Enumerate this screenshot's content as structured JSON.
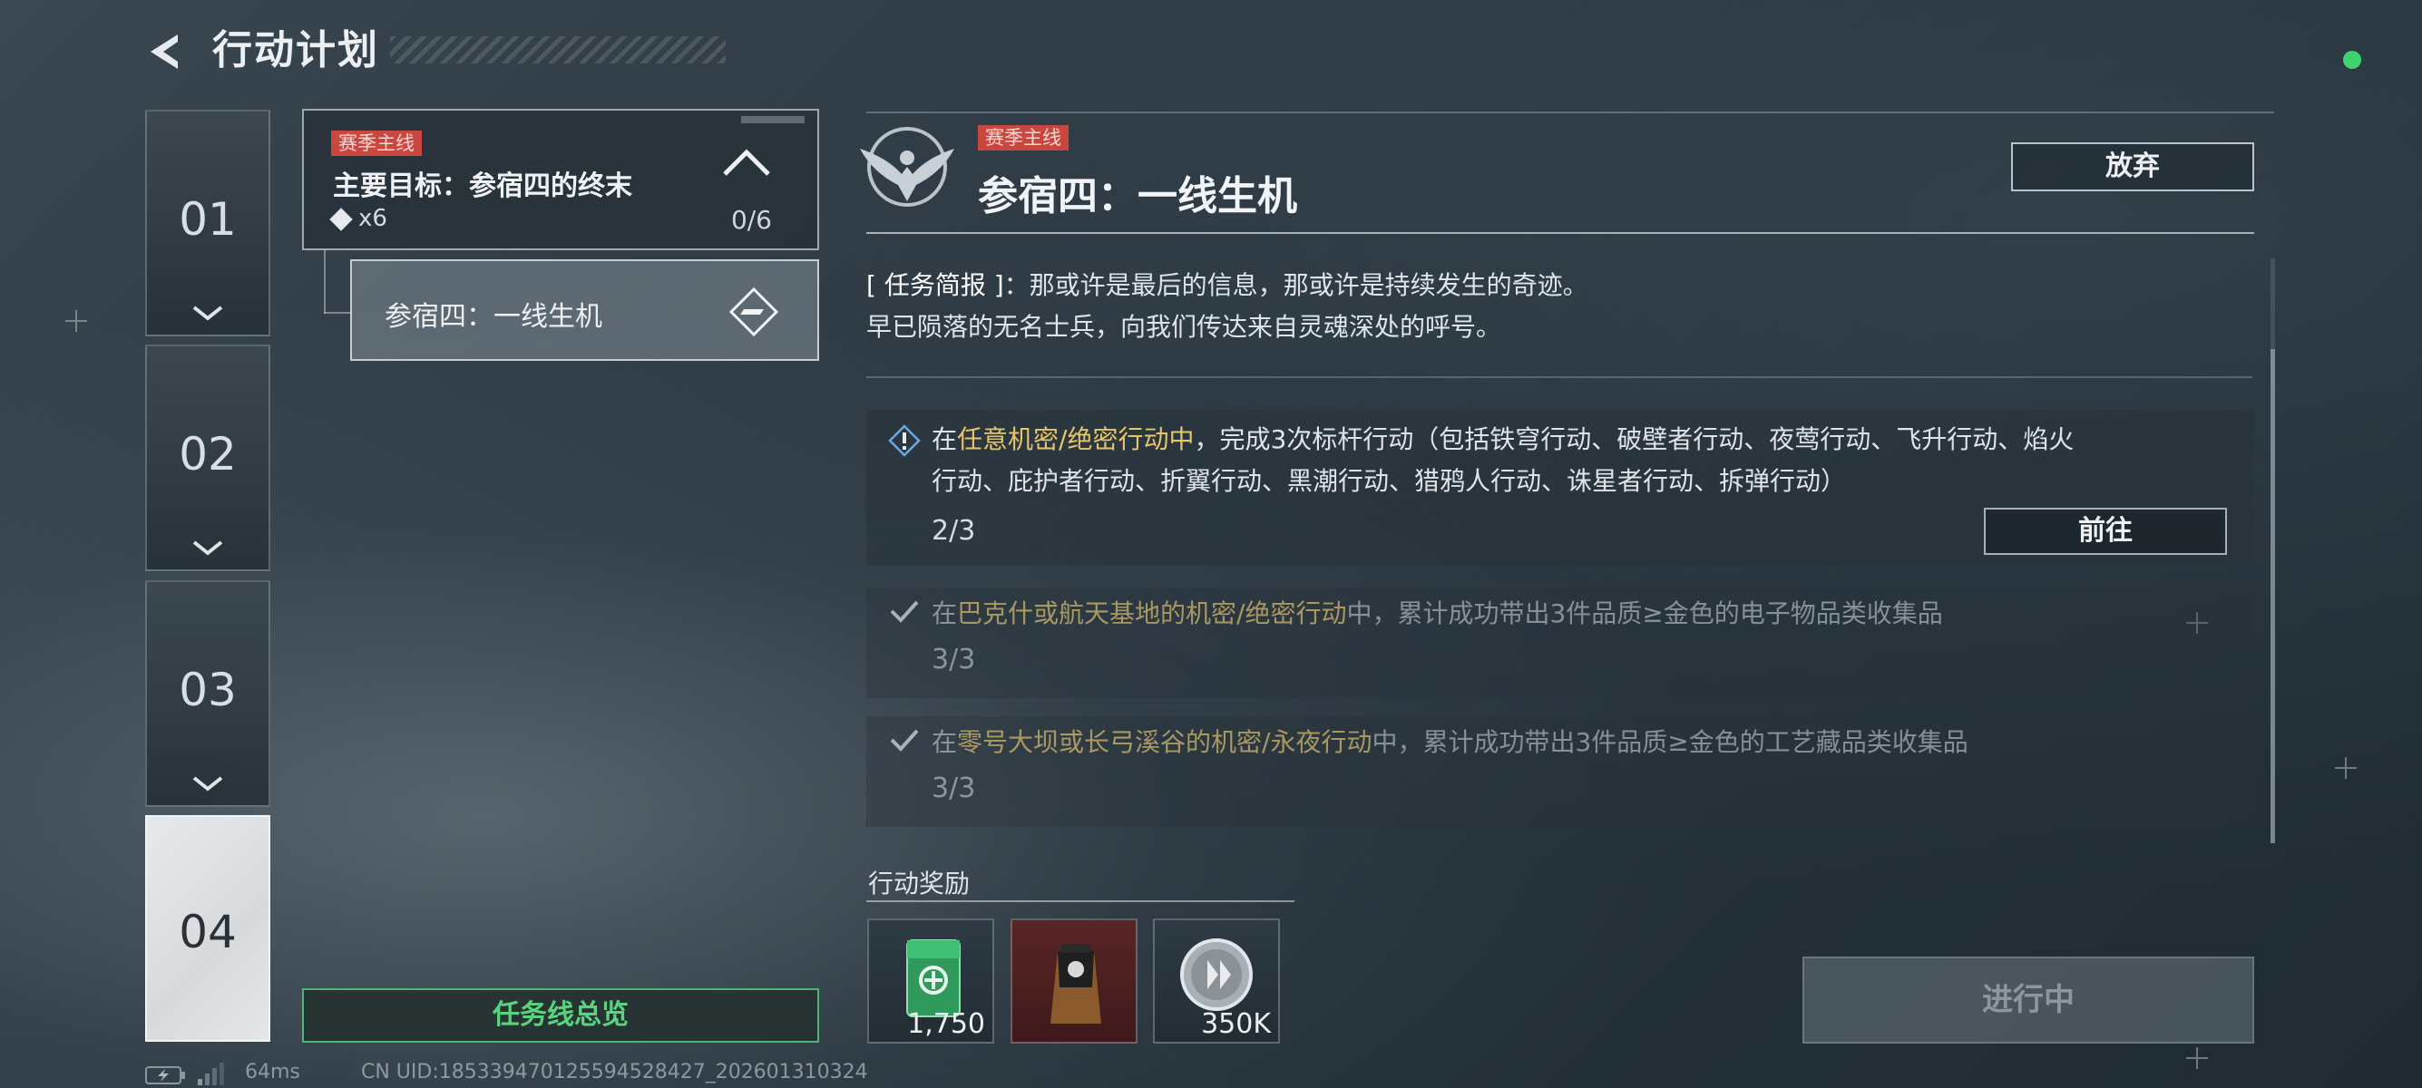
{
  "header": {
    "title": "行动计划"
  },
  "chapters": [
    {
      "label": "01",
      "active": false
    },
    {
      "label": "02",
      "active": false
    },
    {
      "label": "03",
      "active": false
    },
    {
      "label": "04",
      "active": true
    }
  ],
  "mission_card": {
    "tag": "赛季主线",
    "title": "主要目标：参宿四的终末",
    "reward": "x6",
    "progress": "0/6"
  },
  "sub_mission": {
    "label": "参宿四：一线生机"
  },
  "overview_button": "任务线总览",
  "status_bar": {
    "ping": "64ms",
    "uid": "CN UID:18533947012559452842​7_202601310324"
  },
  "detail": {
    "tag": "赛季主线",
    "title": "参宿四：一线生机",
    "abandon_label": "放弃",
    "briefing": {
      "prefix": "[ 任务简报 ]",
      "line1": "：那或许是最后的信息，那或许是持续发生的奇迹。",
      "line2": "早已陨落的无名士兵，向我们传达来自灵魂深处的呼号。"
    },
    "objectives": [
      {
        "state": "in-progress",
        "pre": "在",
        "highlight": "任意机密/绝密行动中",
        "post": "，完成3次标杆行动（包括铁穹行动、破壁者行动、夜莺行动、飞升行动、焰火",
        "line2": "行动、庇护者行动、折翼行动、黑潮行动、猎鸦人行动、诛星者行动、拆弹行动）",
        "progress": "2/3",
        "action": "前往"
      },
      {
        "state": "done",
        "pre": "在",
        "highlight": "巴克什或航天基地的机密/绝密行动",
        "post": "中，累计成功带出3件品质≥金色的电子物品类收集品",
        "progress": "3/3"
      },
      {
        "state": "done",
        "pre": "在",
        "highlight": "零号大坝或长弓溪谷的机密/永夜行动",
        "post": "中，累计成功带出3件品质≥金色的工艺藏品类收集品",
        "progress": "3/3"
      }
    ],
    "rewards_title": "行动奖励",
    "rewards": [
      {
        "icon": "green-box-icon",
        "qty": "1,750"
      },
      {
        "icon": "coffee-bag-icon",
        "qty": ""
      },
      {
        "icon": "silver-coin-icon",
        "qty": "350K"
      }
    ],
    "in_progress_label": "进行中"
  },
  "colors": {
    "accent_red": "#c9473f",
    "accent_green": "#58d47f",
    "highlight_gold": "#e6c66a",
    "status_dot": "#3fd46f"
  }
}
